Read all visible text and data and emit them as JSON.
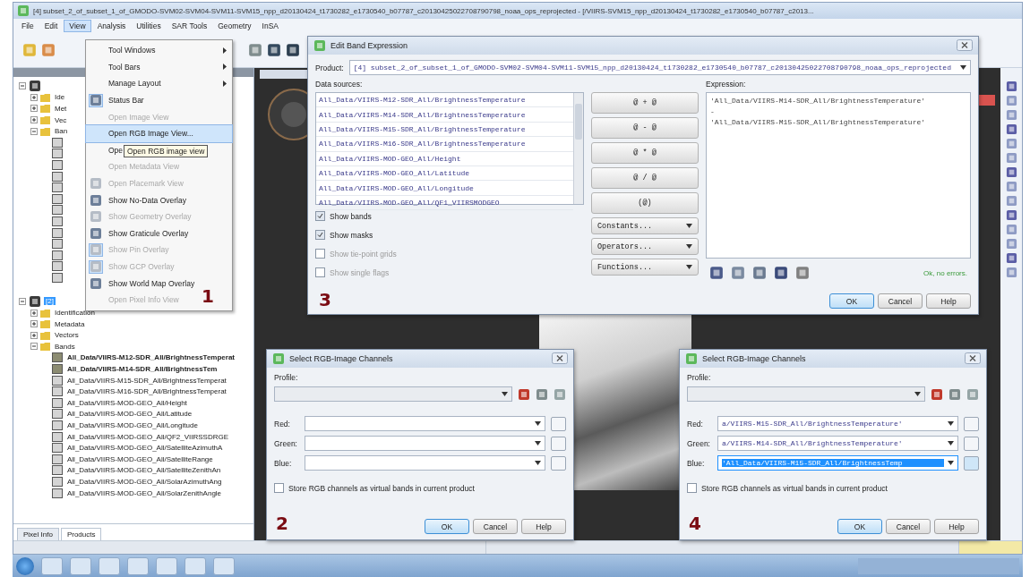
{
  "window": {
    "title": "[4] subset_2_of_subset_1_of_GMODO-SVM02-SVM04-SVM11-SVM15_npp_d20130424_t1730282_e1730540_b07787_c20130425022708790798_noaa_ops_reprojected - [/VIIRS-SVM15_npp_d20130424_t1730282_e1730540_b07787_c2013..."
  },
  "menu_bar": [
    {
      "label": "File",
      "selected": false
    },
    {
      "label": "Edit",
      "selected": false
    },
    {
      "label": "View",
      "selected": true
    },
    {
      "label": "Analysis",
      "selected": false
    },
    {
      "label": "Utilities",
      "selected": false
    },
    {
      "label": "SAR Tools",
      "selected": false
    },
    {
      "label": "Geometry",
      "selected": false
    },
    {
      "label": "InSA",
      "selected": false
    }
  ],
  "view_menu": {
    "items": [
      {
        "label": "Tool Windows",
        "kind": "submenu",
        "disabled": false,
        "selected": false,
        "checked": false
      },
      {
        "label": "Tool Bars",
        "kind": "submenu",
        "disabled": false,
        "selected": false,
        "checked": false
      },
      {
        "label": "Manage Layout",
        "kind": "submenu",
        "disabled": false,
        "selected": false,
        "checked": false
      },
      {
        "label": "Status Bar",
        "kind": "action",
        "disabled": false,
        "selected": false,
        "checked": true
      },
      {
        "label": "Open Image View",
        "kind": "action",
        "disabled": true,
        "selected": false,
        "checked": false
      },
      {
        "label": "Open RGB Image View...",
        "kind": "action",
        "disabled": false,
        "selected": true,
        "checked": false
      },
      {
        "label": "Ope",
        "kind": "action",
        "disabled": false,
        "selected": false,
        "checked": false
      },
      {
        "label": "Open Metadata View",
        "kind": "action",
        "disabled": true,
        "selected": false,
        "checked": false
      },
      {
        "label": "Open Placemark View",
        "kind": "toggle",
        "disabled": true,
        "selected": false,
        "checked": false
      },
      {
        "label": "Show No-Data Overlay",
        "kind": "toggle",
        "disabled": false,
        "selected": false,
        "checked": false
      },
      {
        "label": "Show Geometry Overlay",
        "kind": "toggle",
        "disabled": true,
        "selected": false,
        "checked": false
      },
      {
        "label": "Show Graticule Overlay",
        "kind": "toggle",
        "disabled": false,
        "selected": false,
        "checked": false
      },
      {
        "label": "Show Pin Overlay",
        "kind": "toggle",
        "disabled": true,
        "selected": false,
        "checked": true
      },
      {
        "label": "Show GCP Overlay",
        "kind": "toggle",
        "disabled": true,
        "selected": false,
        "checked": true
      },
      {
        "label": "Show World Map Overlay",
        "kind": "toggle",
        "disabled": false,
        "selected": false,
        "checked": false
      },
      {
        "label": "Open Pixel Info View",
        "kind": "action",
        "disabled": true,
        "selected": false,
        "checked": false
      }
    ],
    "tooltip": "Open RGB image view",
    "callout": "1"
  },
  "explorer": {
    "tabs": [
      {
        "label": "Pixel Info",
        "selected": false
      },
      {
        "label": "Products",
        "selected": true
      }
    ],
    "tree": [
      {
        "kind": "product",
        "expanded": true,
        "selected": false,
        "children": [
          {
            "kind": "folder",
            "label": "Ide",
            "expanded": false,
            "selected": false
          },
          {
            "kind": "folder",
            "label": "Met",
            "expanded": false,
            "selected": false
          },
          {
            "kind": "folder",
            "label": "Vec",
            "expanded": false,
            "selected": false
          },
          {
            "kind": "folder",
            "label": "Ban",
            "expanded": true,
            "selected": false,
            "children": [
              {
                "kind": "band",
                "selected": false
              },
              {
                "kind": "band",
                "selected": false
              },
              {
                "kind": "band",
                "selected": false
              },
              {
                "kind": "band",
                "selected": false
              },
              {
                "kind": "band",
                "selected": false
              },
              {
                "kind": "band",
                "selected": false
              },
              {
                "kind": "band",
                "selected": false
              },
              {
                "kind": "band",
                "selected": false
              },
              {
                "kind": "band",
                "selected": false
              },
              {
                "kind": "band",
                "selected": false
              },
              {
                "kind": "band",
                "selected": false
              },
              {
                "kind": "band",
                "selected": false
              },
              {
                "kind": "band",
                "selected": false
              }
            ]
          }
        ]
      },
      {
        "kind": "product",
        "label": "[2]",
        "expanded": true,
        "selected": true,
        "children": [
          {
            "kind": "folder",
            "label": "Identification",
            "expanded": false,
            "selected": false
          },
          {
            "kind": "folder",
            "label": "Metadata",
            "expanded": false,
            "selected": false
          },
          {
            "kind": "folder",
            "label": "Vectors",
            "expanded": false,
            "selected": false
          },
          {
            "kind": "folder",
            "label": "Bands",
            "expanded": true,
            "selected": false,
            "children": [
              {
                "kind": "band",
                "label": "All_Data/VIIRS-M12-SDR_All/BrightnessTemperat",
                "selected": false,
                "opened": true
              },
              {
                "kind": "band",
                "label": "All_Data/VIIRS-M14-SDR_All/BrightnessTem",
                "selected": false,
                "opened": true
              },
              {
                "kind": "band",
                "label": "All_Data/VIIRS-M15-SDR_All/BrightnessTemperat",
                "selected": false,
                "opened": false
              },
              {
                "kind": "band",
                "label": "All_Data/VIIRS-M16-SDR_All/BrightnessTemperat",
                "selected": false,
                "opened": false
              },
              {
                "kind": "band",
                "label": "All_Data/VIIRS-MOD-GEO_All/Height",
                "selected": false,
                "opened": false
              },
              {
                "kind": "band",
                "label": "All_Data/VIIRS-MOD-GEO_All/Latitude",
                "selected": false,
                "opened": false
              },
              {
                "kind": "band",
                "label": "All_Data/VIIRS-MOD-GEO_All/Longitude",
                "selected": false,
                "opened": false
              },
              {
                "kind": "band",
                "label": "All_Data/VIIRS-MOD-GEO_All/QF2_VIIRSSDRGE",
                "selected": false,
                "opened": false
              },
              {
                "kind": "band",
                "label": "All_Data/VIIRS-MOD-GEO_All/SatelliteAzimuthA",
                "selected": false,
                "opened": false
              },
              {
                "kind": "band",
                "label": "All_Data/VIIRS-MOD-GEO_All/SatelliteRange",
                "selected": false,
                "opened": false
              },
              {
                "kind": "band",
                "label": "All_Data/VIIRS-MOD-GEO_All/SatelliteZenithAn",
                "selected": false,
                "opened": false
              },
              {
                "kind": "band",
                "label": "All_Data/VIIRS-MOD-GEO_All/SolarAzimuthAng",
                "selected": false,
                "opened": false
              },
              {
                "kind": "band",
                "label": "All_Data/VIIRS-MOD-GEO_All/SolarZenithAngle",
                "selected": false,
                "opened": false
              }
            ]
          }
        ]
      }
    ]
  },
  "band_maths": {
    "title": "Edit Band Expression",
    "product_label": "Product:",
    "product": "[4] subset_2_of_subset_1_of_GMODO-SVM02-SVM04-SVM11-SVM15_npp_d20130424_t1730282_e1730540_b07787_c20130425022708790798_noaa_ops_reprojected",
    "sources_label": "Data sources:",
    "sources": [
      {
        "label": "All_Data/VIIRS-M12-SDR_All/BrightnessTemperature",
        "selected": false
      },
      {
        "label": "All_Data/VIIRS-M14-SDR_All/BrightnessTemperature",
        "selected": false
      },
      {
        "label": "All_Data/VIIRS-M15-SDR_All/BrightnessTemperature",
        "selected": false
      },
      {
        "label": "All_Data/VIIRS-M16-SDR_All/BrightnessTemperature",
        "selected": false
      },
      {
        "label": "All_Data/VIIRS-MOD-GEO_All/Height",
        "selected": false
      },
      {
        "label": "All_Data/VIIRS-MOD-GEO_All/Latitude",
        "selected": false
      },
      {
        "label": "All_Data/VIIRS-MOD-GEO_All/Longitude",
        "selected": false
      },
      {
        "label": "All_Data/VIIRS-MOD-GEO_All/QF1_VIIRSMODGEO",
        "selected": false
      }
    ],
    "options": [
      {
        "label": "Show bands",
        "checked": true,
        "disabled": false
      },
      {
        "label": "Show masks",
        "checked": true,
        "disabled": false
      },
      {
        "label": "Show tie-point grids",
        "checked": false,
        "disabled": true
      },
      {
        "label": "Show single flags",
        "checked": false,
        "disabled": true
      }
    ],
    "operators": [
      {
        "label": "@ + @",
        "kind": "button"
      },
      {
        "label": "@ - @",
        "kind": "button"
      },
      {
        "label": "@ * @",
        "kind": "button"
      },
      {
        "label": "@ / @",
        "kind": "button"
      },
      {
        "label": "(@)",
        "kind": "button"
      },
      {
        "label": "Constants...",
        "kind": "dropdown"
      },
      {
        "label": "Operators...",
        "kind": "dropdown"
      },
      {
        "label": "Functions...",
        "kind": "dropdown"
      }
    ],
    "expression_label": "Expression:",
    "expression": [
      "'All_Data/VIIRS-M14-SDR_All/BrightnessTemperature'",
      "-",
      "'All_Data/VIIRS-M15-SDR_All/BrightnessTemperature'"
    ],
    "status": "Ok, no errors.",
    "buttons": [
      {
        "label": "OK",
        "default": true
      },
      {
        "label": "Cancel",
        "default": false
      },
      {
        "label": "Help",
        "default": false
      }
    ],
    "callout": "3"
  },
  "rgb_dialogs": [
    {
      "title": "Select RGB-Image Channels",
      "profile_label": "Profile:",
      "channels": [
        {
          "label": "Red:",
          "selected": false
        },
        {
          "label": "Green:",
          "selected": false
        },
        {
          "label": "Blue:",
          "selected": false
        }
      ],
      "store_option": {
        "label": "Store RGB channels as virtual bands in current product",
        "checked": false
      },
      "buttons": [
        {
          "label": "OK",
          "default": true
        },
        {
          "label": "Cancel",
          "default": false
        },
        {
          "label": "Help",
          "default": false
        }
      ],
      "callout": "2"
    },
    {
      "title": "Select RGB-Image Channels",
      "profile_label": "Profile:",
      "channels": [
        {
          "label": "Red:",
          "value": "a/VIIRS-M15-SDR_All/BrightnessTemperature'",
          "selected": false
        },
        {
          "label": "Green:",
          "value": "a/VIIRS-M14-SDR_All/BrightnessTemperature'",
          "selected": false
        },
        {
          "label": "Blue:",
          "value": "'All_Data/VIIRS-M15-SDR_All/BrightnessTemp",
          "selected": true
        }
      ],
      "store_option": {
        "label": "Store RGB channels as virtual bands in current product",
        "checked": false
      },
      "buttons": [
        {
          "label": "OK",
          "default": true
        },
        {
          "label": "Cancel",
          "default": false
        },
        {
          "label": "Help",
          "default": false
        }
      ],
      "callout": "4"
    }
  ]
}
